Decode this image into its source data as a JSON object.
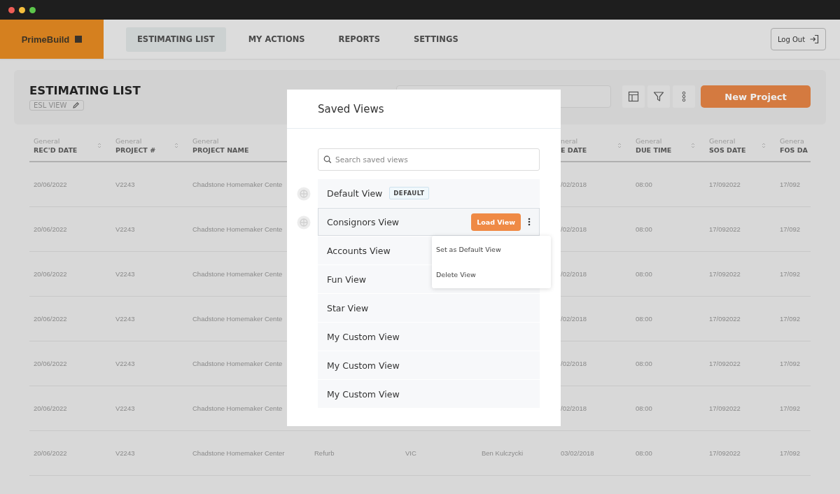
{
  "nav": {
    "logo": "PrimeBuild",
    "tabs": [
      {
        "label": "ESTIMATING LIST",
        "selected": true
      },
      {
        "label": "MY ACTIONS",
        "selected": false
      },
      {
        "label": "REPORTS",
        "selected": false
      },
      {
        "label": "SETTINGS",
        "selected": false
      }
    ],
    "logout": "Log Out"
  },
  "page": {
    "title": "ESTIMATING LIST",
    "view_chip": "ESL VIEW",
    "new_button": "New Project"
  },
  "table": {
    "columns": [
      {
        "group": "General",
        "title": "REC'D DATE",
        "sortable": true
      },
      {
        "group": "General",
        "title": "PROJECT #",
        "sortable": true
      },
      {
        "group": "General",
        "title": "PROJECT NAME",
        "sortable": false
      },
      null,
      null,
      null,
      {
        "group": "neral",
        "title": "E DATE",
        "sortable": true
      },
      {
        "group": "General",
        "title": "DUE TIME",
        "sortable": true
      },
      {
        "group": "General",
        "title": "SOS DATE",
        "sortable": true
      },
      {
        "group": "Genera",
        "title": "FOS DA",
        "sortable": false
      }
    ],
    "rows": [
      [
        "20/06/2022",
        "V2243",
        "Chadstone Homemaker Cente",
        null,
        null,
        null,
        "/02/2018",
        "08:00",
        "17/092022",
        "17/092"
      ],
      [
        "20/06/2022",
        "V2243",
        "Chadstone Homemaker Cente",
        null,
        null,
        null,
        "/02/2018",
        "08:00",
        "17/092022",
        "17/092"
      ],
      [
        "20/06/2022",
        "V2243",
        "Chadstone Homemaker Cente",
        null,
        null,
        null,
        "/02/2018",
        "08:00",
        "17/092022",
        "17/092"
      ],
      [
        "20/06/2022",
        "V2243",
        "Chadstone Homemaker Cente",
        null,
        null,
        null,
        "/02/2018",
        "08:00",
        "17/092022",
        "17/092"
      ],
      [
        "20/06/2022",
        "V2243",
        "Chadstone Homemaker Cente",
        null,
        null,
        null,
        "/02/2018",
        "08:00",
        "17/092022",
        "17/092"
      ],
      [
        "20/06/2022",
        "V2243",
        "Chadstone Homemaker Cente",
        null,
        null,
        null,
        "/02/2018",
        "08:00",
        "17/092022",
        "17/092"
      ],
      [
        "20/06/2022",
        "V2243",
        "Chadstone Homemaker Center",
        "Refurb",
        "VIC",
        "Ben Kulczycki",
        "03/02/2018",
        "08:00",
        "17/092022",
        "17/092"
      ]
    ]
  },
  "modal": {
    "title": "Saved Views",
    "search": {
      "placeholder": "Search saved views"
    },
    "views": [
      {
        "name": "Default View",
        "badge": "DEFAULT",
        "handle": true,
        "selected": false
      },
      {
        "name": "Consignors View",
        "handle": true,
        "selected": true,
        "action": "Load View"
      },
      {
        "name": "Accounts View",
        "handle": false,
        "selected": false
      },
      {
        "name": "Fun View",
        "handle": false,
        "selected": false
      },
      {
        "name": "Star View",
        "handle": false,
        "selected": false
      },
      {
        "name": "My Custom View",
        "handle": false,
        "selected": false
      },
      {
        "name": "My Custom View",
        "handle": false,
        "selected": false
      },
      {
        "name": "My Custom View",
        "handle": false,
        "selected": false
      }
    ],
    "menu": {
      "items": [
        "Set as Default View",
        "Delete View"
      ]
    }
  }
}
